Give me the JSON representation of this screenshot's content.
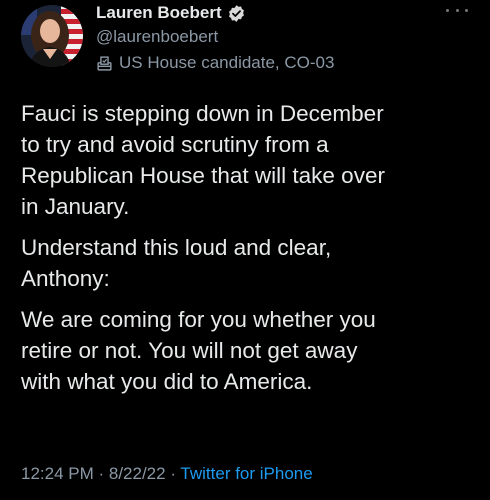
{
  "author": {
    "display_name": "Lauren Boebert",
    "handle": "@laurenboebert",
    "label": "US House candidate, CO-03",
    "verified_icon": "verified-badge-icon",
    "label_icon": "ballot-box-icon"
  },
  "tweet": {
    "paragraphs": [
      "Fauci is stepping down in December\nto try and avoid scrutiny from a\nRepublican House that will take over\nin January.",
      "Understand this loud and clear,\nAnthony:",
      "We are coming for you whether you\nretire or not. You will not get away\nwith what you did to America."
    ]
  },
  "meta": {
    "time": "12:24 PM",
    "sep1": " · ",
    "date": "8/22/22",
    "sep2": " · ",
    "source": "Twitter for iPhone"
  },
  "colors": {
    "background": "#000000",
    "text": "#e7e9ea",
    "secondary": "#8b98a5",
    "accent": "#1d9bf0"
  }
}
